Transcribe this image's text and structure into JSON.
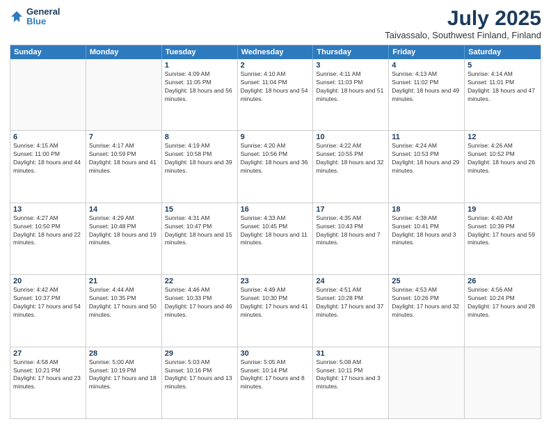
{
  "header": {
    "logo_line1": "General",
    "logo_line2": "Blue",
    "month": "July 2025",
    "location": "Taivassalo, Southwest Finland, Finland"
  },
  "weekdays": [
    "Sunday",
    "Monday",
    "Tuesday",
    "Wednesday",
    "Thursday",
    "Friday",
    "Saturday"
  ],
  "weeks": [
    [
      {
        "day": "",
        "info": ""
      },
      {
        "day": "",
        "info": ""
      },
      {
        "day": "1",
        "info": "Sunrise: 4:09 AM\nSunset: 11:05 PM\nDaylight: 18 hours and 56 minutes."
      },
      {
        "day": "2",
        "info": "Sunrise: 4:10 AM\nSunset: 11:04 PM\nDaylight: 18 hours and 54 minutes."
      },
      {
        "day": "3",
        "info": "Sunrise: 4:11 AM\nSunset: 11:03 PM\nDaylight: 18 hours and 51 minutes."
      },
      {
        "day": "4",
        "info": "Sunrise: 4:13 AM\nSunset: 11:02 PM\nDaylight: 18 hours and 49 minutes."
      },
      {
        "day": "5",
        "info": "Sunrise: 4:14 AM\nSunset: 11:01 PM\nDaylight: 18 hours and 47 minutes."
      }
    ],
    [
      {
        "day": "6",
        "info": "Sunrise: 4:15 AM\nSunset: 11:00 PM\nDaylight: 18 hours and 44 minutes."
      },
      {
        "day": "7",
        "info": "Sunrise: 4:17 AM\nSunset: 10:59 PM\nDaylight: 18 hours and 41 minutes."
      },
      {
        "day": "8",
        "info": "Sunrise: 4:19 AM\nSunset: 10:58 PM\nDaylight: 18 hours and 39 minutes."
      },
      {
        "day": "9",
        "info": "Sunrise: 4:20 AM\nSunset: 10:56 PM\nDaylight: 18 hours and 36 minutes."
      },
      {
        "day": "10",
        "info": "Sunrise: 4:22 AM\nSunset: 10:55 PM\nDaylight: 18 hours and 32 minutes."
      },
      {
        "day": "11",
        "info": "Sunrise: 4:24 AM\nSunset: 10:53 PM\nDaylight: 18 hours and 29 minutes."
      },
      {
        "day": "12",
        "info": "Sunrise: 4:26 AM\nSunset: 10:52 PM\nDaylight: 18 hours and 26 minutes."
      }
    ],
    [
      {
        "day": "13",
        "info": "Sunrise: 4:27 AM\nSunset: 10:50 PM\nDaylight: 18 hours and 22 minutes."
      },
      {
        "day": "14",
        "info": "Sunrise: 4:29 AM\nSunset: 10:48 PM\nDaylight: 18 hours and 19 minutes."
      },
      {
        "day": "15",
        "info": "Sunrise: 4:31 AM\nSunset: 10:47 PM\nDaylight: 18 hours and 15 minutes."
      },
      {
        "day": "16",
        "info": "Sunrise: 4:33 AM\nSunset: 10:45 PM\nDaylight: 18 hours and 11 minutes."
      },
      {
        "day": "17",
        "info": "Sunrise: 4:35 AM\nSunset: 10:43 PM\nDaylight: 18 hours and 7 minutes."
      },
      {
        "day": "18",
        "info": "Sunrise: 4:38 AM\nSunset: 10:41 PM\nDaylight: 18 hours and 3 minutes."
      },
      {
        "day": "19",
        "info": "Sunrise: 4:40 AM\nSunset: 10:39 PM\nDaylight: 17 hours and 59 minutes."
      }
    ],
    [
      {
        "day": "20",
        "info": "Sunrise: 4:42 AM\nSunset: 10:37 PM\nDaylight: 17 hours and 54 minutes."
      },
      {
        "day": "21",
        "info": "Sunrise: 4:44 AM\nSunset: 10:35 PM\nDaylight: 17 hours and 50 minutes."
      },
      {
        "day": "22",
        "info": "Sunrise: 4:46 AM\nSunset: 10:33 PM\nDaylight: 17 hours and 46 minutes."
      },
      {
        "day": "23",
        "info": "Sunrise: 4:49 AM\nSunset: 10:30 PM\nDaylight: 17 hours and 41 minutes."
      },
      {
        "day": "24",
        "info": "Sunrise: 4:51 AM\nSunset: 10:28 PM\nDaylight: 17 hours and 37 minutes."
      },
      {
        "day": "25",
        "info": "Sunrise: 4:53 AM\nSunset: 10:26 PM\nDaylight: 17 hours and 32 minutes."
      },
      {
        "day": "26",
        "info": "Sunrise: 4:56 AM\nSunset: 10:24 PM\nDaylight: 17 hours and 28 minutes."
      }
    ],
    [
      {
        "day": "27",
        "info": "Sunrise: 4:58 AM\nSunset: 10:21 PM\nDaylight: 17 hours and 23 minutes."
      },
      {
        "day": "28",
        "info": "Sunrise: 5:00 AM\nSunset: 10:19 PM\nDaylight: 17 hours and 18 minutes."
      },
      {
        "day": "29",
        "info": "Sunrise: 5:03 AM\nSunset: 10:16 PM\nDaylight: 17 hours and 13 minutes."
      },
      {
        "day": "30",
        "info": "Sunrise: 5:05 AM\nSunset: 10:14 PM\nDaylight: 17 hours and 8 minutes."
      },
      {
        "day": "31",
        "info": "Sunrise: 5:08 AM\nSunset: 10:11 PM\nDaylight: 17 hours and 3 minutes."
      },
      {
        "day": "",
        "info": ""
      },
      {
        "day": "",
        "info": ""
      }
    ]
  ]
}
